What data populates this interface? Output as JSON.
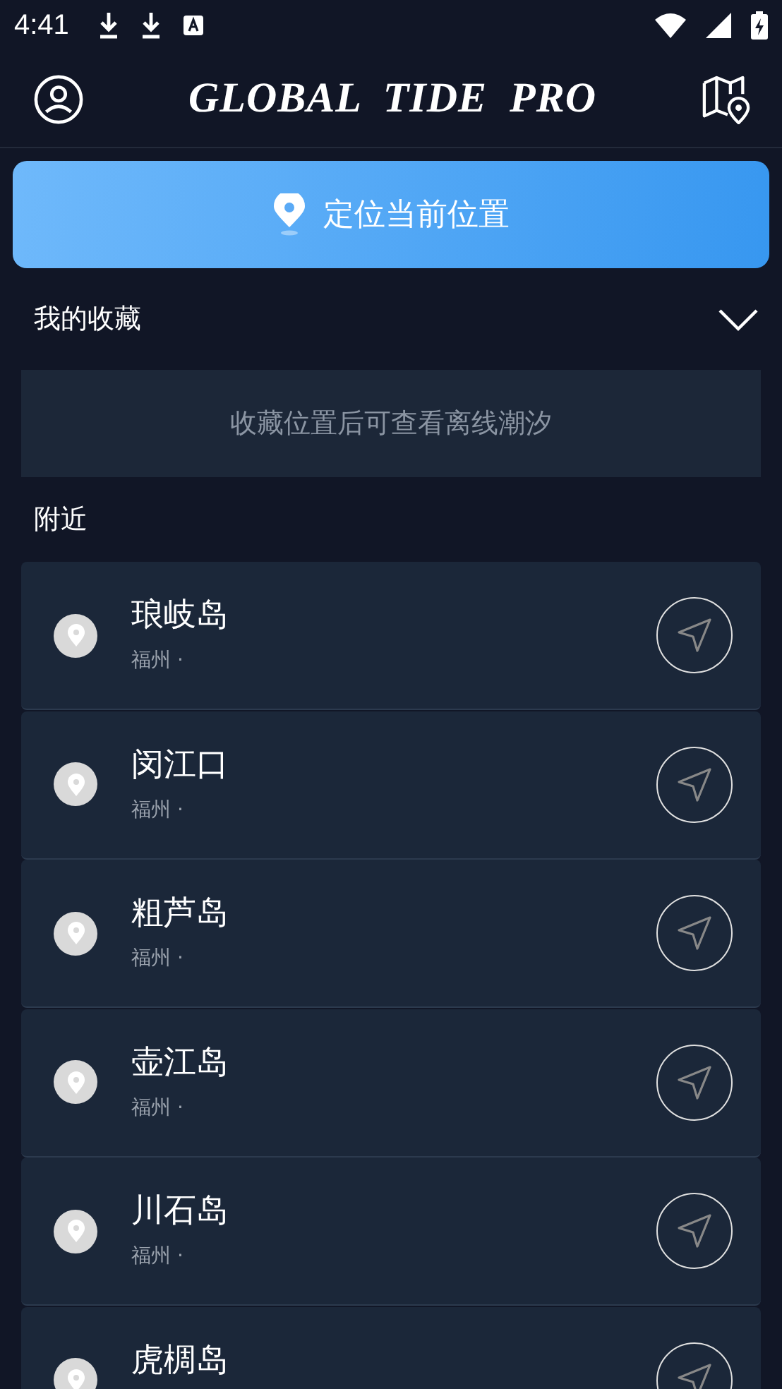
{
  "status_bar": {
    "time": "4:41"
  },
  "header": {
    "title": "GLOBAL  TIDE  PRO"
  },
  "locate_button": {
    "label": "定位当前位置"
  },
  "favorites": {
    "title": "我的收藏",
    "expanded": true,
    "empty_message": "收藏位置后可查看离线潮汐"
  },
  "nearby": {
    "title": "附近",
    "items": [
      {
        "name": "琅岐岛",
        "region": "福州 ·"
      },
      {
        "name": "闵江口",
        "region": "福州 ·"
      },
      {
        "name": "粗芦岛",
        "region": "福州 ·"
      },
      {
        "name": "壶江岛",
        "region": "福州 ·"
      },
      {
        "name": "川石岛",
        "region": "福州 ·"
      },
      {
        "name": "虎椆岛"
      }
    ]
  }
}
